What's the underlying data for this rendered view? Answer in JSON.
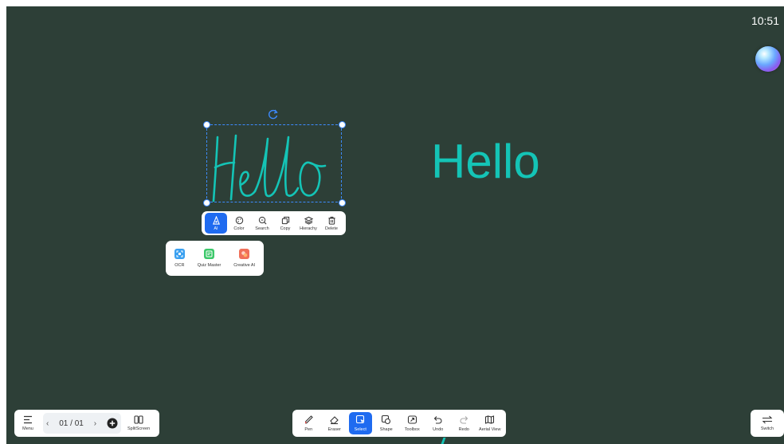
{
  "status": {
    "clock": "10:51"
  },
  "canvas": {
    "typed_text": "Hello",
    "ink_color": "#14c4b6",
    "selection_color": "#3d8bff",
    "background": "#2d3f37"
  },
  "context_toolbar": {
    "items": [
      {
        "label": "AI",
        "icon": "ai-icon",
        "active": true
      },
      {
        "label": "Color",
        "icon": "palette-icon"
      },
      {
        "label": "Search",
        "icon": "search-icon"
      },
      {
        "label": "Copy",
        "icon": "copy-icon"
      },
      {
        "label": "Hierachy",
        "icon": "layers-icon"
      },
      {
        "label": "Delete",
        "icon": "trash-icon"
      }
    ]
  },
  "ai_panel": {
    "items": [
      {
        "label": "OCR",
        "icon": "ocr-icon",
        "color": "#3aa0f0"
      },
      {
        "label": "Quiz Master",
        "icon": "quiz-icon",
        "color": "#3cc86a"
      },
      {
        "label": "Creative AI",
        "icon": "creative-ai-icon",
        "color": "#f0705a"
      }
    ]
  },
  "nav": {
    "menu_label": "Menu",
    "page_indicator": "01 / 01",
    "prev": "‹",
    "next": "›",
    "split_label": "SplitScreen"
  },
  "toolbar": {
    "items": [
      {
        "label": "Pen",
        "icon": "pen-icon"
      },
      {
        "label": "Eraser",
        "icon": "eraser-icon"
      },
      {
        "label": "Select",
        "icon": "select-icon",
        "active": true
      },
      {
        "label": "Shape",
        "icon": "shape-icon"
      },
      {
        "label": "Toolbox",
        "icon": "toolbox-icon"
      },
      {
        "label": "Undo",
        "icon": "undo-icon"
      },
      {
        "label": "Redo",
        "icon": "redo-icon"
      },
      {
        "label": "Aerial View",
        "icon": "aerial-view-icon"
      }
    ]
  },
  "switch": {
    "label": "Switch"
  },
  "accent": "#1f6bf0"
}
